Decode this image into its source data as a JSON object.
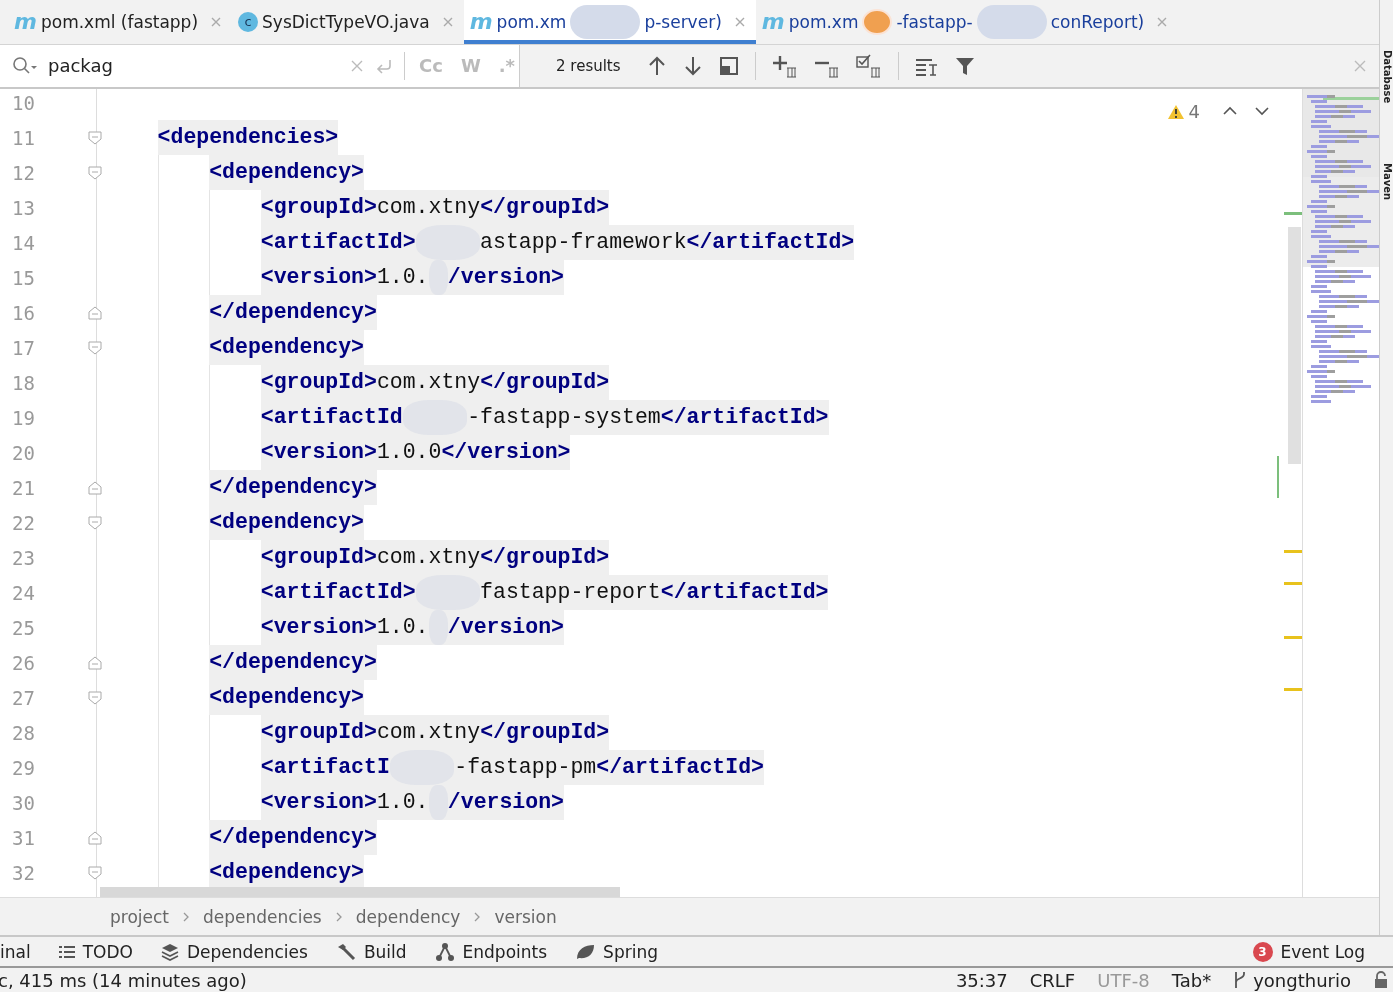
{
  "tabs": [
    {
      "kind": "maven",
      "icon_text": "m",
      "parts": [
        {
          "kind": "text",
          "t": "pom.xml (fastapp)"
        }
      ],
      "selected": false
    },
    {
      "kind": "class",
      "icon_text": "c",
      "parts": [
        {
          "kind": "text",
          "t": "SysDictTypeVO.java"
        }
      ],
      "selected": false
    },
    {
      "kind": "maven",
      "icon_text": "m",
      "parts": [
        {
          "kind": "text",
          "t": "pom.xm"
        },
        {
          "kind": "blur"
        },
        {
          "kind": "text",
          "t": "p-server)"
        }
      ],
      "selected": true
    },
    {
      "kind": "maven",
      "icon_text": "m",
      "parts": [
        {
          "kind": "text",
          "t": "pom.xm"
        },
        {
          "kind": "sticker"
        },
        {
          "kind": "text",
          "t": "-fastapp-"
        },
        {
          "kind": "blur"
        },
        {
          "kind": "text",
          "t": "conReport)"
        }
      ],
      "selected": false
    }
  ],
  "search": {
    "value": "packag",
    "match_case": "Cc",
    "words": "W",
    "regex": ".*",
    "results": "2 results"
  },
  "warnings": {
    "count": "4"
  },
  "lines": [
    {
      "number": "10"
    },
    {
      "number": "11",
      "kind": "fold-start",
      "parts": [
        {
          "kind": "tag",
          "t": "<dependencies>"
        }
      ],
      "children": [
        {
          "number": "12",
          "kind": "fold-start",
          "parts": [
            {
              "kind": "tag",
              "t": "<dependency>"
            }
          ],
          "children": [
            {
              "number": "13",
              "parts": [
                {
                  "kind": "tag",
                  "t": "<groupId>"
                },
                {
                  "kind": "text",
                  "t": "com.xtny"
                },
                {
                  "kind": "tag",
                  "t": "</groupId>"
                }
              ]
            },
            {
              "number": "14",
              "parts": [
                {
                  "kind": "tag",
                  "t": "<artifactId>"
                },
                {
                  "kind": "blur"
                },
                {
                  "kind": "text",
                  "t": "astapp-framework"
                },
                {
                  "kind": "tag",
                  "t": "</artifactId>"
                }
              ]
            },
            {
              "number": "15",
              "parts": [
                {
                  "kind": "tag",
                  "t": "<version>"
                },
                {
                  "kind": "text",
                  "t": "1.0."
                },
                {
                  "kind": "blur"
                },
                {
                  "kind": "tag",
                  "t": "/version>"
                }
              ]
            }
          ]
        },
        {
          "number": "16",
          "kind": "fold-end",
          "parts": [
            {
              "kind": "tag",
              "t": "</dependency>"
            }
          ]
        },
        {
          "number": "17",
          "kind": "fold-start",
          "parts": [
            {
              "kind": "tag",
              "t": "<dependency>"
            }
          ],
          "children": [
            {
              "number": "18",
              "parts": [
                {
                  "kind": "tag",
                  "t": "<groupId>"
                },
                {
                  "kind": "text",
                  "t": "com.xtny"
                },
                {
                  "kind": "tag",
                  "t": "</groupId>"
                }
              ]
            },
            {
              "number": "19",
              "parts": [
                {
                  "kind": "tag",
                  "t": "<artifactId"
                },
                {
                  "kind": "blur"
                },
                {
                  "kind": "text",
                  "t": "-fastapp-system"
                },
                {
                  "kind": "tag",
                  "t": "</artifactId>"
                }
              ]
            },
            {
              "number": "20",
              "parts": [
                {
                  "kind": "tag",
                  "t": "<version>"
                },
                {
                  "kind": "text",
                  "t": "1.0.0"
                },
                {
                  "kind": "tag",
                  "t": "</version>"
                }
              ]
            }
          ]
        },
        {
          "number": "21",
          "kind": "fold-end",
          "parts": [
            {
              "kind": "tag",
              "t": "</dependency>"
            }
          ]
        },
        {
          "number": "22",
          "kind": "fold-start",
          "parts": [
            {
              "kind": "tag",
              "t": "<dependency>"
            }
          ],
          "children": [
            {
              "number": "23",
              "parts": [
                {
                  "kind": "tag",
                  "t": "<groupId>"
                },
                {
                  "kind": "text",
                  "t": "com.xtny"
                },
                {
                  "kind": "tag",
                  "t": "</groupId>"
                }
              ]
            },
            {
              "number": "24",
              "parts": [
                {
                  "kind": "tag",
                  "t": "<artifactId>"
                },
                {
                  "kind": "blur"
                },
                {
                  "kind": "text",
                  "t": "fastapp-report"
                },
                {
                  "kind": "tag",
                  "t": "</artifactId>"
                }
              ]
            },
            {
              "number": "25",
              "parts": [
                {
                  "kind": "tag",
                  "t": "<version>"
                },
                {
                  "kind": "text",
                  "t": "1.0."
                },
                {
                  "kind": "blur"
                },
                {
                  "kind": "tag",
                  "t": "/version>"
                }
              ]
            }
          ]
        },
        {
          "number": "26",
          "kind": "fold-end",
          "parts": [
            {
              "kind": "tag",
              "t": "</dependency>"
            }
          ]
        },
        {
          "number": "27",
          "kind": "fold-start",
          "parts": [
            {
              "kind": "tag",
              "t": "<dependency>"
            }
          ],
          "children": [
            {
              "number": "28",
              "parts": [
                {
                  "kind": "tag",
                  "t": "<groupId>"
                },
                {
                  "kind": "text",
                  "t": "com.xtny"
                },
                {
                  "kind": "tag",
                  "t": "</groupId>"
                }
              ]
            },
            {
              "number": "29",
              "parts": [
                {
                  "kind": "tag",
                  "t": "<artifactI"
                },
                {
                  "kind": "blur"
                },
                {
                  "kind": "text",
                  "t": "-fastapp-pm"
                },
                {
                  "kind": "tag",
                  "t": "</artifactId>"
                }
              ]
            },
            {
              "number": "30",
              "parts": [
                {
                  "kind": "tag",
                  "t": "<version>"
                },
                {
                  "kind": "text",
                  "t": "1.0."
                },
                {
                  "kind": "blur"
                },
                {
                  "kind": "tag",
                  "t": "/version>"
                }
              ]
            }
          ]
        },
        {
          "number": "31",
          "kind": "fold-end",
          "parts": [
            {
              "kind": "tag",
              "t": "</dependency>"
            }
          ]
        },
        {
          "number": "32",
          "kind": "fold-start",
          "parts": [
            {
              "kind": "tag",
              "t": "<dependency>"
            }
          ]
        }
      ]
    }
  ],
  "side_tabs": [
    "Database",
    "Maven"
  ],
  "breadcrumb": [
    "project",
    "dependencies",
    "dependency",
    "version"
  ],
  "tool_windows": [
    {
      "kind": "terminal",
      "label": "inal"
    },
    {
      "kind": "todo",
      "label": "TODO"
    },
    {
      "kind": "dependencies",
      "label": "Dependencies"
    },
    {
      "kind": "build",
      "label": "Build"
    },
    {
      "kind": "endpoints",
      "label": "Endpoints"
    },
    {
      "kind": "spring",
      "label": "Spring"
    }
  ],
  "event_log": {
    "badge": "3",
    "label": "Event Log"
  },
  "status_bar": {
    "message": "c, 415 ms (14 minutes ago)",
    "position": "35:37",
    "line_ending": "CRLF",
    "encoding": "UTF-8",
    "indent": "Tab*",
    "branch": "yongthurio"
  }
}
